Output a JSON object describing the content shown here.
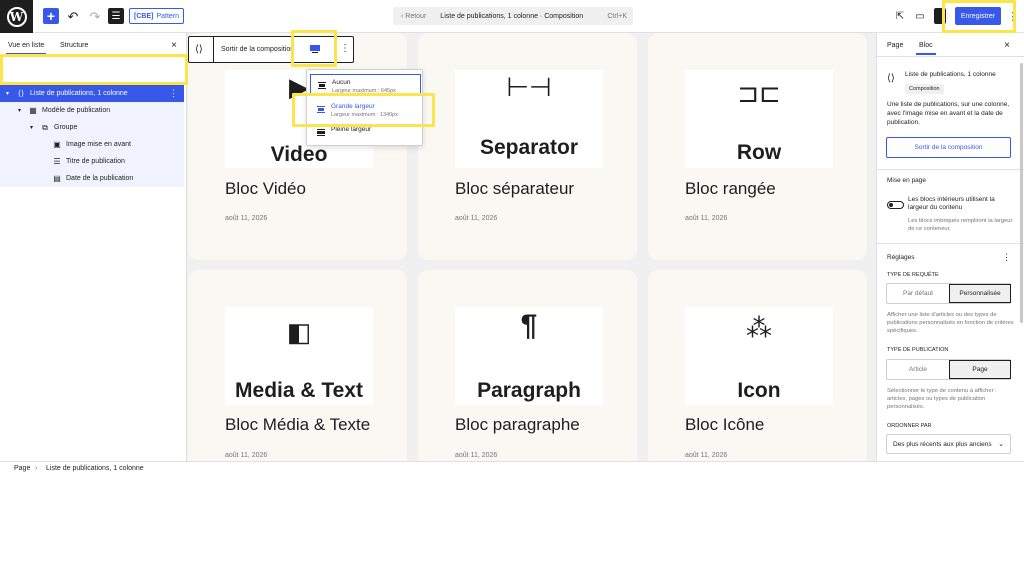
{
  "topbar": {
    "undo_icon": "↶",
    "redo_icon": "↷",
    "add_icon": "+",
    "pattern_label": "Pattern",
    "pattern_badge": "[CBE]",
    "command": {
      "back": "‹  Retour",
      "title": "Liste de publications, 1 colonne · Composition",
      "shortcut": "Ctrl+K"
    },
    "save_label": "Enregistrer"
  },
  "left_sidebar": {
    "tab_list": "Vue en liste",
    "tab_outline": "Structure",
    "close": "×",
    "tree": [
      {
        "label": "Liste de publications, 1 colonne",
        "icon": "query-loop-icon",
        "glyph": "⟨⟩",
        "selected": true
      },
      {
        "label": "Modèle de publication",
        "icon": "post-template-icon",
        "glyph": "▦"
      },
      {
        "label": "Groupe",
        "icon": "group-icon",
        "glyph": "⧉"
      },
      {
        "label": "Image mise en avant",
        "icon": "featured-image-icon",
        "glyph": "▣"
      },
      {
        "label": "Titre de publication",
        "icon": "post-title-icon",
        "glyph": "☰"
      },
      {
        "label": "Date de la publication",
        "icon": "post-date-icon",
        "glyph": "▤"
      }
    ]
  },
  "block_toolbar": {
    "parent_icon": "⟨⟩",
    "exit_label": "Sortir de la composition",
    "more": "⋮"
  },
  "alignment_menu": {
    "items": [
      {
        "label": "Aucun",
        "sub": "Largeur maximum : 645px"
      },
      {
        "label": "Grande largeur",
        "sub": "Largeur maximum : 1340px"
      },
      {
        "label": "Pleine largeur",
        "sub": ""
      }
    ]
  },
  "cards": [
    {
      "glyph": "▶",
      "word": "Video",
      "title": "Bloc Vidéo",
      "date": "août 11, 2026"
    },
    {
      "glyph": "⊢⊣",
      "word": "Separator",
      "title": "Bloc séparateur",
      "date": "août 11, 2026"
    },
    {
      "glyph": "⊐⊏",
      "word": "Row",
      "title": "Bloc rangée",
      "date": "août 11, 2026"
    },
    {
      "glyph": "◧",
      "word": "Media & Text",
      "title": "Bloc Média & Texte",
      "date": "août 11, 2026"
    },
    {
      "glyph": "¶",
      "word": "Paragraph",
      "title": "Bloc paragraphe",
      "date": "août 11, 2026"
    },
    {
      "glyph": "⁂",
      "word": "Icon",
      "title": "Bloc Icône",
      "date": "août 11, 2026"
    }
  ],
  "right_sidebar": {
    "tab_page": "Page",
    "tab_block": "Bloc",
    "close": "×",
    "block_name": "Liste de publications, 1 colonne",
    "block_badge": "Composition",
    "block_desc": "Une liste de publications, sur une colonne, avec l'image mise en avant et la date de publication.",
    "exit_button": "Sortir de la composition",
    "layout_heading": "Mise en page",
    "toggle_label": "Les blocs intérieurs utilisent la largeur du contenu",
    "toggle_help": "Les blocs imbriqués rempliront la largeur de ce conteneur.",
    "settings_heading": "Réglages",
    "query_type_label": "TYPE DE REQUÊTE",
    "query_default": "Par défaut",
    "query_custom": "Personnalisée",
    "query_help": "Afficher une liste d'articles ou des types de publications personnalisés en fonction de critères spécifiques.",
    "post_type_label": "TYPE DE PUBLICATION",
    "post_type_article": "Article",
    "post_type_page": "Page",
    "post_type_help": "Sélectionner le type de contenu à afficher : articles, pages ou types de publication personnalisés.",
    "order_label": "ORDONNER PAR",
    "order_value": "Des plus récents aux plus anciens"
  },
  "footer": {
    "crumb_1": "Page",
    "separator": "›",
    "crumb_2": "Liste de publications, 1 colonne"
  },
  "colors": {
    "accent": "#3858e9",
    "highlight": "#fbe54d",
    "card_bg": "#faf8f2"
  }
}
